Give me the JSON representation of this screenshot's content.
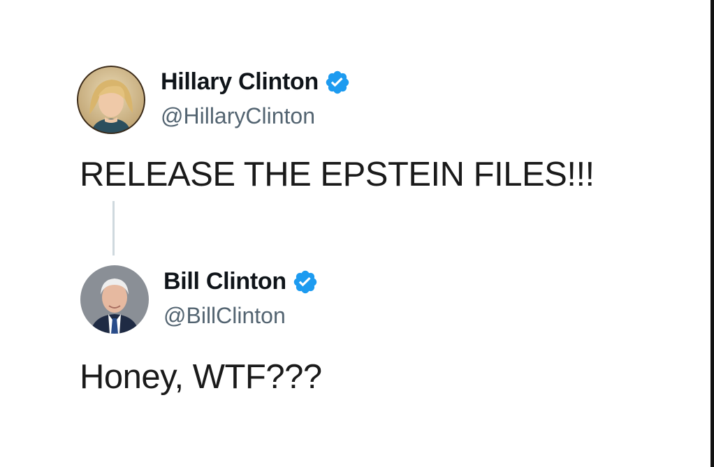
{
  "tweets": [
    {
      "author": "Hillary Clinton",
      "handle": "@HillaryClinton",
      "verified": true,
      "text": "RELEASE THE EPSTEIN FILES!!!"
    },
    {
      "author": "Bill Clinton",
      "handle": "@BillClinton",
      "verified": true,
      "text": "Honey, WTF???"
    }
  ],
  "colors": {
    "verified_badge": "#1d9bf0",
    "handle": "#536471",
    "thread_line": "#cfd9de"
  },
  "icons": [
    "avatar",
    "verified-badge-icon"
  ]
}
